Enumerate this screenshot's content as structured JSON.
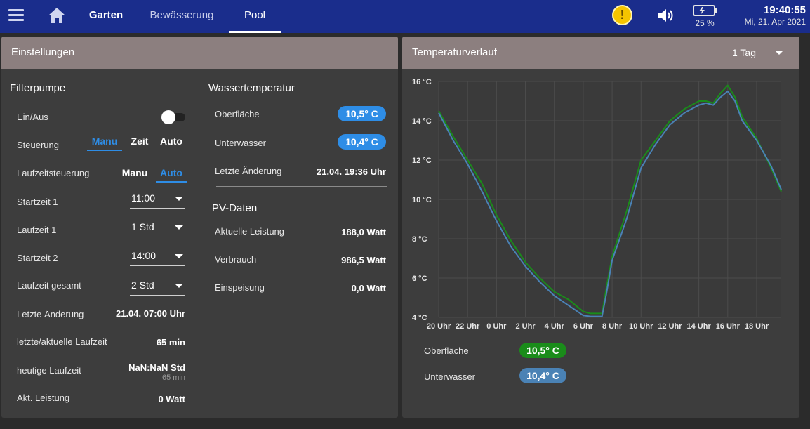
{
  "topbar": {
    "tabs": [
      {
        "label": "Garten"
      },
      {
        "label": "Bewässerung"
      },
      {
        "label": "Pool"
      }
    ],
    "warning_glyph": "!",
    "battery_percent": "25 %",
    "time": "19:40:55",
    "date": "Mi, 21. Apr 2021",
    "icons": [
      "menu-icon",
      "home-icon",
      "warning-icon",
      "speaker-icon",
      "battery-icon"
    ],
    "colors": {
      "bar": "#1a2d8c",
      "warning": "#f5c400"
    }
  },
  "settings": {
    "title": "Einstellungen",
    "filterpumpe": {
      "title": "Filterpumpe",
      "rows": {
        "onoff": "Ein/Aus",
        "steuerung": "Steuerung",
        "laufzeitsteuerung": "Laufzeitsteuerung",
        "startzeit1": "Startzeit 1",
        "laufzeit1": "Laufzeit 1",
        "startzeit2": "Startzeit 2",
        "laufzeit_gesamt": "Laufzeit gesamt",
        "letzte_aenderung": "Letzte Änderung",
        "laufzeit_letzte": "letzte/aktuelle Laufzeit",
        "heutige_laufzeit": "heutige Laufzeit",
        "akt_leistung": "Akt. Leistung"
      },
      "toggle_on": false,
      "steuerung_options": [
        "Manu",
        "Zeit",
        "Auto"
      ],
      "steuerung_selected": "Manu",
      "laufzeit_options": [
        "Manu",
        "Auto"
      ],
      "laufzeit_selected": "Auto",
      "startzeit1_value": "11:00",
      "laufzeit1_value": "1 Std",
      "startzeit2_value": "14:00",
      "laufzeit_gesamt_value": "2 Std",
      "letzte_aenderung_value": "21.04. 07:00 Uhr",
      "laufzeit_letzte_value": "65 min",
      "heutige_laufzeit_value": "NaN:NaN Std",
      "heutige_laufzeit_sub": "65 min",
      "akt_leistung_value": "0 Watt"
    },
    "wasser": {
      "title": "Wassertemperatur",
      "oberflaeche_label": "Oberfläche",
      "oberflaeche_value": "10,5° C",
      "unterwasser_label": "Unterwasser",
      "unterwasser_value": "10,4° C",
      "letzte_label": "Letzte Änderung",
      "letzte_value": "21.04. 19:36 Uhr"
    },
    "pv": {
      "title": "PV-Daten",
      "leistung_label": "Aktuelle Leistung",
      "leistung_value": "188,0 Watt",
      "verbrauch_label": "Verbrauch",
      "verbrauch_value": "986,5 Watt",
      "einspeisung_label": "Einspeisung",
      "einspeisung_value": "0,0 Watt"
    }
  },
  "temperature": {
    "title": "Temperaturverlauf",
    "range_value": "1 Tag",
    "legend": [
      {
        "label": "Oberfläche",
        "value": "10,5° C",
        "color": "#1a8c1a"
      },
      {
        "label": "Unterwasser",
        "value": "10,4° C",
        "color": "#4a82b5"
      }
    ]
  },
  "chart_data": {
    "type": "line",
    "title": "",
    "xlabel": "",
    "ylabel": "",
    "ylim": [
      4,
      16
    ],
    "y_ticks": [
      "4 °C",
      "6 °C",
      "8 °C",
      "10 °C",
      "12 °C",
      "14 °C",
      "16 °C"
    ],
    "y_tick_values": [
      4,
      6,
      8,
      10,
      12,
      14,
      16
    ],
    "x_ticks": [
      "20 Uhr",
      "22 Uhr",
      "0 Uhr",
      "2 Uhr",
      "4 Uhr",
      "6 Uhr",
      "8 Uhr",
      "10 Uhr",
      "12 Uhr",
      "14 Uhr",
      "16 Uhr",
      "18 Uhr"
    ],
    "x_tick_values": [
      20,
      22,
      24,
      26,
      28,
      30,
      32,
      34,
      36,
      38,
      40,
      42
    ],
    "xlim": [
      20,
      43.7
    ],
    "grid": true,
    "series": [
      {
        "name": "Oberfläche",
        "color": "#1a8c1a",
        "x": [
          20,
          21,
          22,
          23,
          24,
          25,
          26,
          27,
          28,
          29,
          30,
          30.5,
          31,
          31.3,
          31.6,
          32,
          33,
          34,
          35,
          36,
          37,
          38,
          38.5,
          39,
          39.5,
          40,
          40.5,
          41,
          42,
          43,
          43.7
        ],
        "y": [
          14.5,
          13.2,
          12.0,
          10.8,
          9.2,
          7.9,
          6.8,
          6.0,
          5.3,
          4.9,
          4.3,
          4.2,
          4.2,
          4.2,
          5.5,
          7.1,
          9.4,
          12.0,
          13.0,
          14.0,
          14.6,
          15.0,
          15.0,
          14.9,
          15.4,
          15.8,
          15.2,
          14.2,
          13.1,
          11.6,
          10.4
        ]
      },
      {
        "name": "Unterwasser",
        "color": "#4a82b5",
        "x": [
          20,
          21,
          22,
          23,
          24,
          25,
          26,
          27,
          28,
          29,
          30,
          30.5,
          31,
          31.3,
          31.6,
          32,
          33,
          34,
          35,
          36,
          37,
          38,
          38.5,
          39,
          39.5,
          40,
          40.5,
          41,
          42,
          43,
          43.7
        ],
        "y": [
          14.4,
          13.0,
          11.8,
          10.4,
          8.9,
          7.6,
          6.6,
          5.8,
          5.1,
          4.6,
          4.1,
          4.05,
          4.05,
          4.05,
          5.2,
          6.9,
          9.0,
          11.6,
          12.8,
          13.8,
          14.4,
          14.8,
          14.9,
          14.8,
          15.2,
          15.5,
          15.0,
          14.0,
          13.0,
          11.7,
          10.5
        ]
      }
    ]
  }
}
